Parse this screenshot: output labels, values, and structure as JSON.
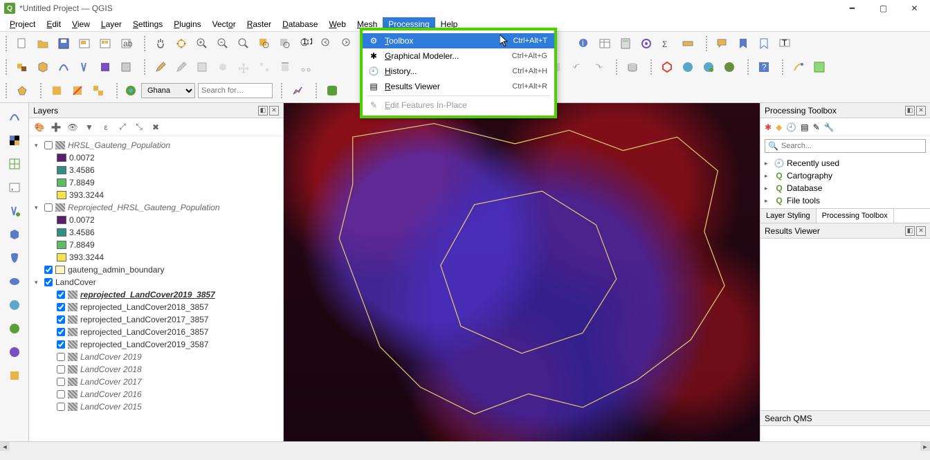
{
  "window": {
    "title": "*Untitled Project — QGIS"
  },
  "menubar": [
    "Project",
    "Edit",
    "View",
    "Layer",
    "Settings",
    "Plugins",
    "Vector",
    "Raster",
    "Database",
    "Web",
    "Mesh",
    "Processing",
    "Help"
  ],
  "menubar_underline_idx": [
    0,
    0,
    0,
    0,
    0,
    0,
    4,
    0,
    0,
    0,
    0,
    3,
    0
  ],
  "menubar_active": "Processing",
  "processing_menu": [
    {
      "label": "Toolbox",
      "shortcut": "Ctrl+Alt+T",
      "highlight": true,
      "icon": "toolbox"
    },
    {
      "label": "Graphical Modeler...",
      "shortcut": "Ctrl+Alt+G",
      "icon": "modeler"
    },
    {
      "label": "History...",
      "shortcut": "Ctrl+Alt+H",
      "icon": "history"
    },
    {
      "label": "Results Viewer",
      "shortcut": "Ctrl+Alt+R",
      "icon": "results"
    },
    {
      "label": "Edit Features In-Place",
      "shortcut": "",
      "disabled": true,
      "icon": "edit"
    }
  ],
  "locator": {
    "combo_value": "Ghana",
    "search_placeholder": "Search for…"
  },
  "layers_panel": {
    "title": "Layers"
  },
  "layers": [
    {
      "type": "group",
      "expanded": true,
      "checked": false,
      "icon": "raster",
      "label": "HRSL_Gauteng_Population",
      "italic": true,
      "children": [
        {
          "swatch": "#5B1E6E",
          "label": "0.0072"
        },
        {
          "swatch": "#2F8F84",
          "label": "3.4586"
        },
        {
          "swatch": "#5DBB63",
          "label": "7.8849"
        },
        {
          "swatch": "#F7E24A",
          "label": "393.3244"
        }
      ]
    },
    {
      "type": "group",
      "expanded": true,
      "checked": false,
      "icon": "raster",
      "label": "Reprojected_HRSL_Gauteng_Population",
      "italic": true,
      "children": [
        {
          "swatch": "#5B1E6E",
          "label": "0.0072"
        },
        {
          "swatch": "#2F8F84",
          "label": "3.4586"
        },
        {
          "swatch": "#5DBB63",
          "label": "7.8849"
        },
        {
          "swatch": "#F7E24A",
          "label": "393.3244"
        }
      ]
    },
    {
      "type": "layer",
      "checked": true,
      "icon": "poly",
      "label": "gauteng_admin_boundary"
    },
    {
      "type": "group",
      "expanded": true,
      "checked": true,
      "icon": "none",
      "label": "LandCover",
      "children": [
        {
          "type": "layer",
          "checked": true,
          "icon": "raster",
          "label": "reprojected_LandCover2019_3857",
          "bold": true
        },
        {
          "type": "layer",
          "checked": true,
          "icon": "raster",
          "label": "reprojected_LandCover2018_3857"
        },
        {
          "type": "layer",
          "checked": true,
          "icon": "raster",
          "label": "reprojected_LandCover2017_3857"
        },
        {
          "type": "layer",
          "checked": true,
          "icon": "raster",
          "label": "reprojected_LandCover2016_3857"
        },
        {
          "type": "layer",
          "checked": true,
          "icon": "raster",
          "label": "reprojected_LandCover2019_3587"
        },
        {
          "type": "layer",
          "checked": false,
          "icon": "raster",
          "label": "LandCover 2019",
          "italic": true
        },
        {
          "type": "layer",
          "checked": false,
          "icon": "raster",
          "label": "LandCover 2018",
          "italic": true
        },
        {
          "type": "layer",
          "checked": false,
          "icon": "raster",
          "label": "LandCover 2017",
          "italic": true
        },
        {
          "type": "layer",
          "checked": false,
          "icon": "raster",
          "label": "LandCover 2016",
          "italic": true
        },
        {
          "type": "layer",
          "checked": false,
          "icon": "raster",
          "label": "LandCover 2015",
          "italic": true
        }
      ]
    }
  ],
  "toolbox_panel": {
    "title": "Processing Toolbox",
    "search_placeholder": "Search..."
  },
  "toolbox_tree": [
    {
      "icon": "clock",
      "label": "Recently used"
    },
    {
      "icon": "qgis",
      "label": "Cartography"
    },
    {
      "icon": "qgis",
      "label": "Database"
    },
    {
      "icon": "qgis",
      "label": "File tools"
    }
  ],
  "right_tabs": [
    "Layer Styling",
    "Processing Toolbox"
  ],
  "right_tab_active": "Processing Toolbox",
  "results_panel": {
    "title": "Results Viewer"
  },
  "qms_panel": {
    "title": "Search QMS"
  }
}
